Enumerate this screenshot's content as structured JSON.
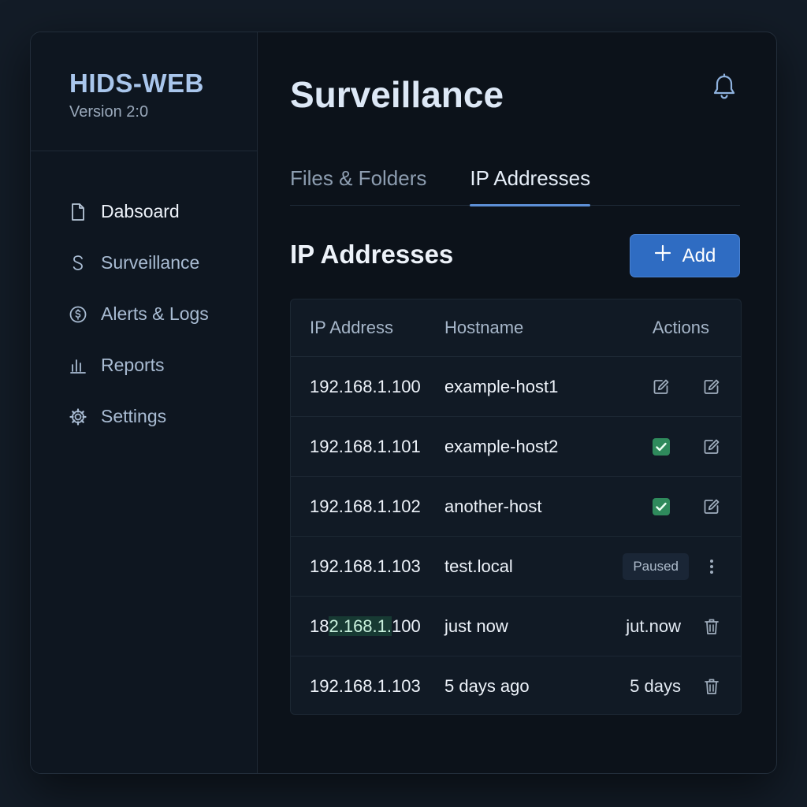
{
  "app": {
    "name": "HIDS-WEB",
    "version": "Version 2:0"
  },
  "sidebar": {
    "items": [
      {
        "label": "Dabsoard",
        "icon": "document-icon",
        "active": true
      },
      {
        "label": "Surveillance",
        "icon": "s-letter-icon",
        "active": false
      },
      {
        "label": "Alerts & Logs",
        "icon": "coin-alert-icon",
        "active": false
      },
      {
        "label": "Reports",
        "icon": "bar-chart-icon",
        "active": false
      },
      {
        "label": "Settings",
        "icon": "gear-icon",
        "active": false
      }
    ]
  },
  "header": {
    "title": "Surveillance",
    "bell_icon": "bell-icon"
  },
  "tabs": [
    {
      "label": "Files & Folders",
      "active": false
    },
    {
      "label": "IP Addresses",
      "active": true
    }
  ],
  "section": {
    "title": "IP Addresses",
    "add_label": "Add"
  },
  "table": {
    "headers": {
      "ip": "IP Address",
      "hostname": "Hostname",
      "actions": "Actions"
    },
    "rows": [
      {
        "ip": "192.168.1.100",
        "hostname": "example-host1",
        "actions": [
          "edit-icon",
          "edit-icon"
        ]
      },
      {
        "ip": "192.168.1.101",
        "hostname": "example-host2",
        "actions": [
          "check-icon",
          "edit-icon"
        ]
      },
      {
        "ip": "192.168.1.102",
        "hostname": "another-host",
        "actions": [
          "check-icon",
          "edit-icon"
        ]
      },
      {
        "ip": "192.168.1.103",
        "hostname": "test.local",
        "status": "Paused",
        "actions": [
          "more-icon"
        ]
      },
      {
        "ip_prefix": "18",
        "ip_highlight": "2.168.1.",
        "ip_suffix": "100",
        "hostname": "just now",
        "action_text": "jut.now",
        "actions": [
          "trash-icon"
        ]
      },
      {
        "ip": "192.168.1.103",
        "hostname": "5 days ago",
        "action_text": "5 days",
        "actions": [
          "trash-icon"
        ]
      }
    ]
  },
  "colors": {
    "accent": "#2f6cc2",
    "brand": "#a9c6ec",
    "success": "#2f8a5c",
    "background": "#0c121a"
  }
}
